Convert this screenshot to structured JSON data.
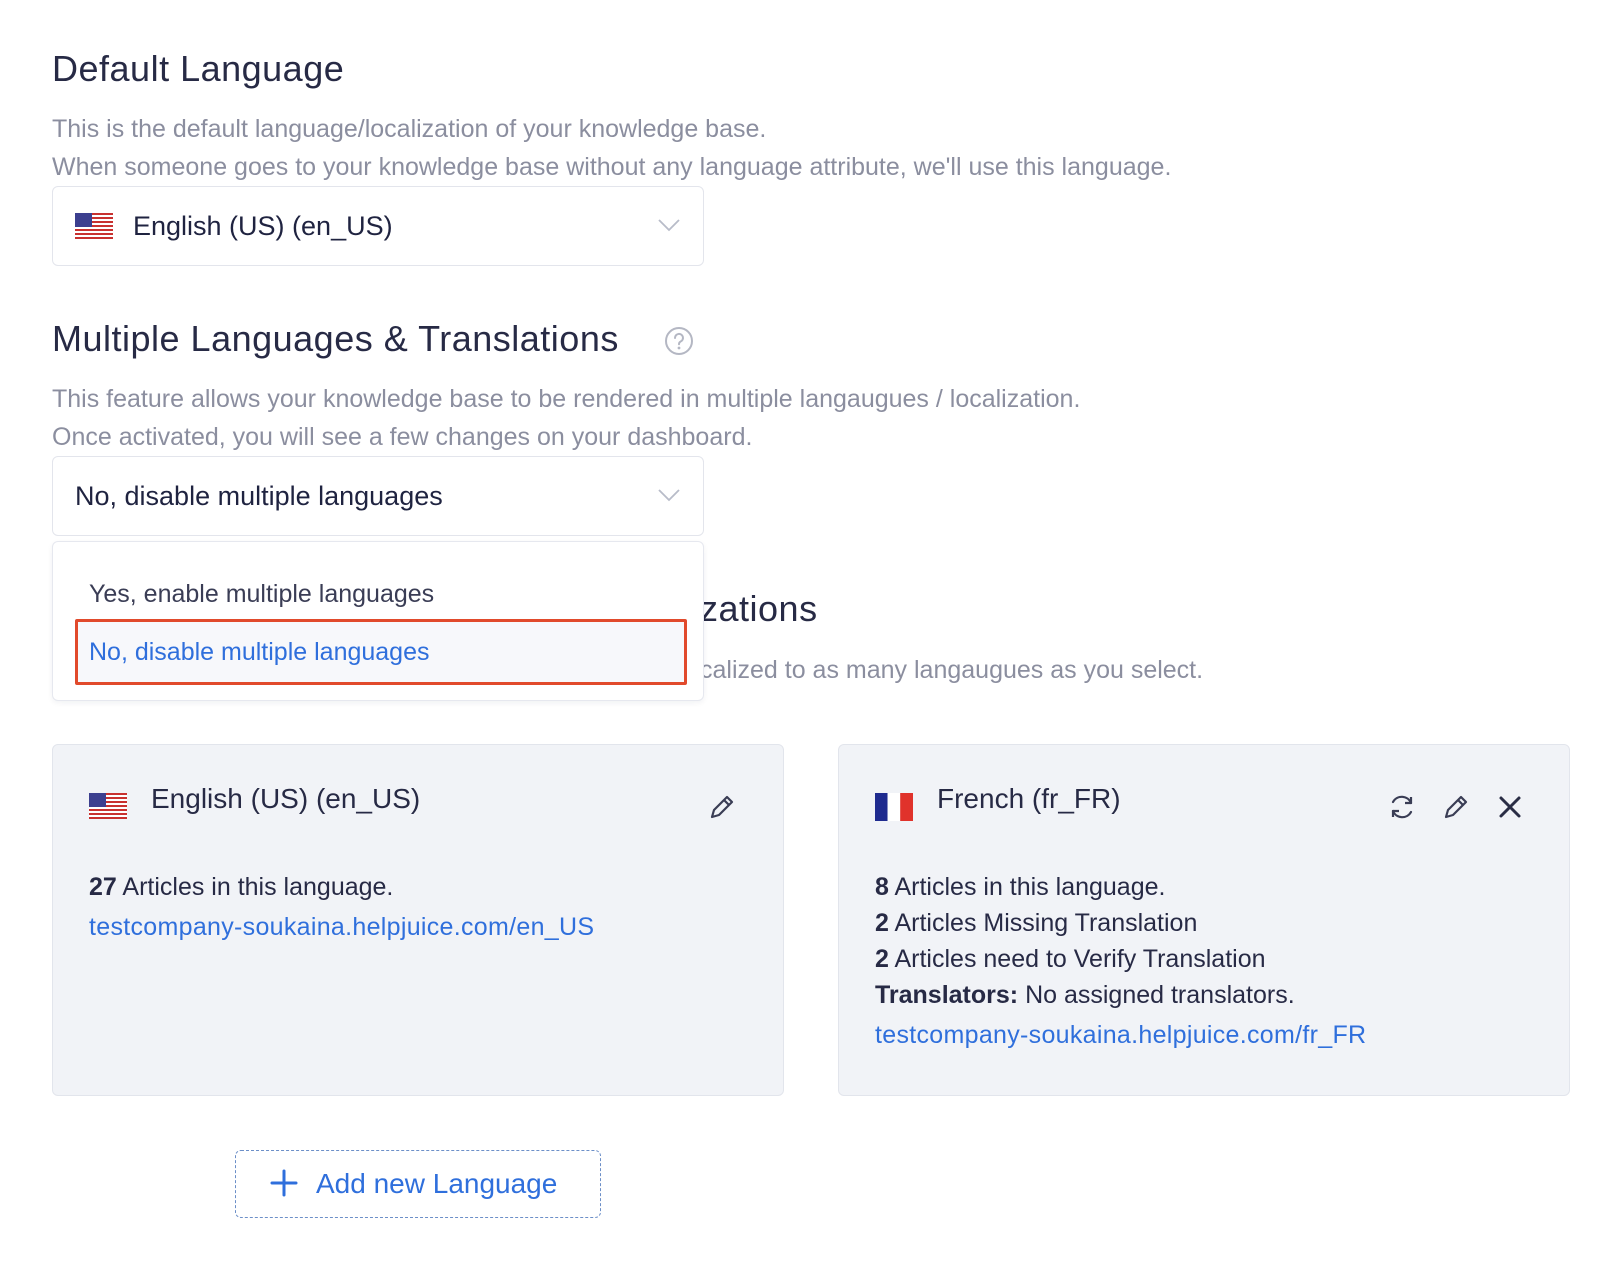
{
  "default_language": {
    "title": "Default Language",
    "desc_line1": "This is the default language/localization of your knowledge base.",
    "desc_line2": "When someone goes to your knowledge base without any language attribute, we'll use this language.",
    "selected": "English (US) (en_US)",
    "flag_icon": "us-flag-icon"
  },
  "multiple_languages": {
    "title": "Multiple Languages & Translations",
    "help_icon": "question-circle-icon",
    "desc_line1": "This feature allows your knowledge base to be rendered in multiple langaugues / localization.",
    "desc_line2": "Once activated, you will see a few changes on your dashboard.",
    "selected": "No, disable multiple languages",
    "options": [
      "Yes, enable multiple languages",
      "No, disable multiple languages"
    ],
    "highlight_color": "#e14a2c",
    "active_option_color": "#2f6fdc"
  },
  "localizations": {
    "title_partial": "zations",
    "desc_partial": "calized to as many langaugues as you select."
  },
  "cards": [
    {
      "flag_icon": "us-flag-icon",
      "name": "English (US) (en_US)",
      "articles_count": "27",
      "articles_label": "Articles in this language.",
      "url": "testcompany-soukaina.helpjuice.com/en_US"
    },
    {
      "flag_icon": "fr-flag-icon",
      "name": "French (fr_FR)",
      "articles_count": "8",
      "articles_label": "Articles in this language.",
      "missing_count": "2",
      "missing_label": "Articles Missing Translation",
      "verify_count": "2",
      "verify_label": "Articles need to Verify Translation",
      "translators_label": "Translators:",
      "translators_value": "No assigned translators.",
      "url": "testcompany-soukaina.helpjuice.com/fr_FR"
    }
  ],
  "add_button": {
    "label": "Add new Language",
    "icon": "plus-icon"
  }
}
